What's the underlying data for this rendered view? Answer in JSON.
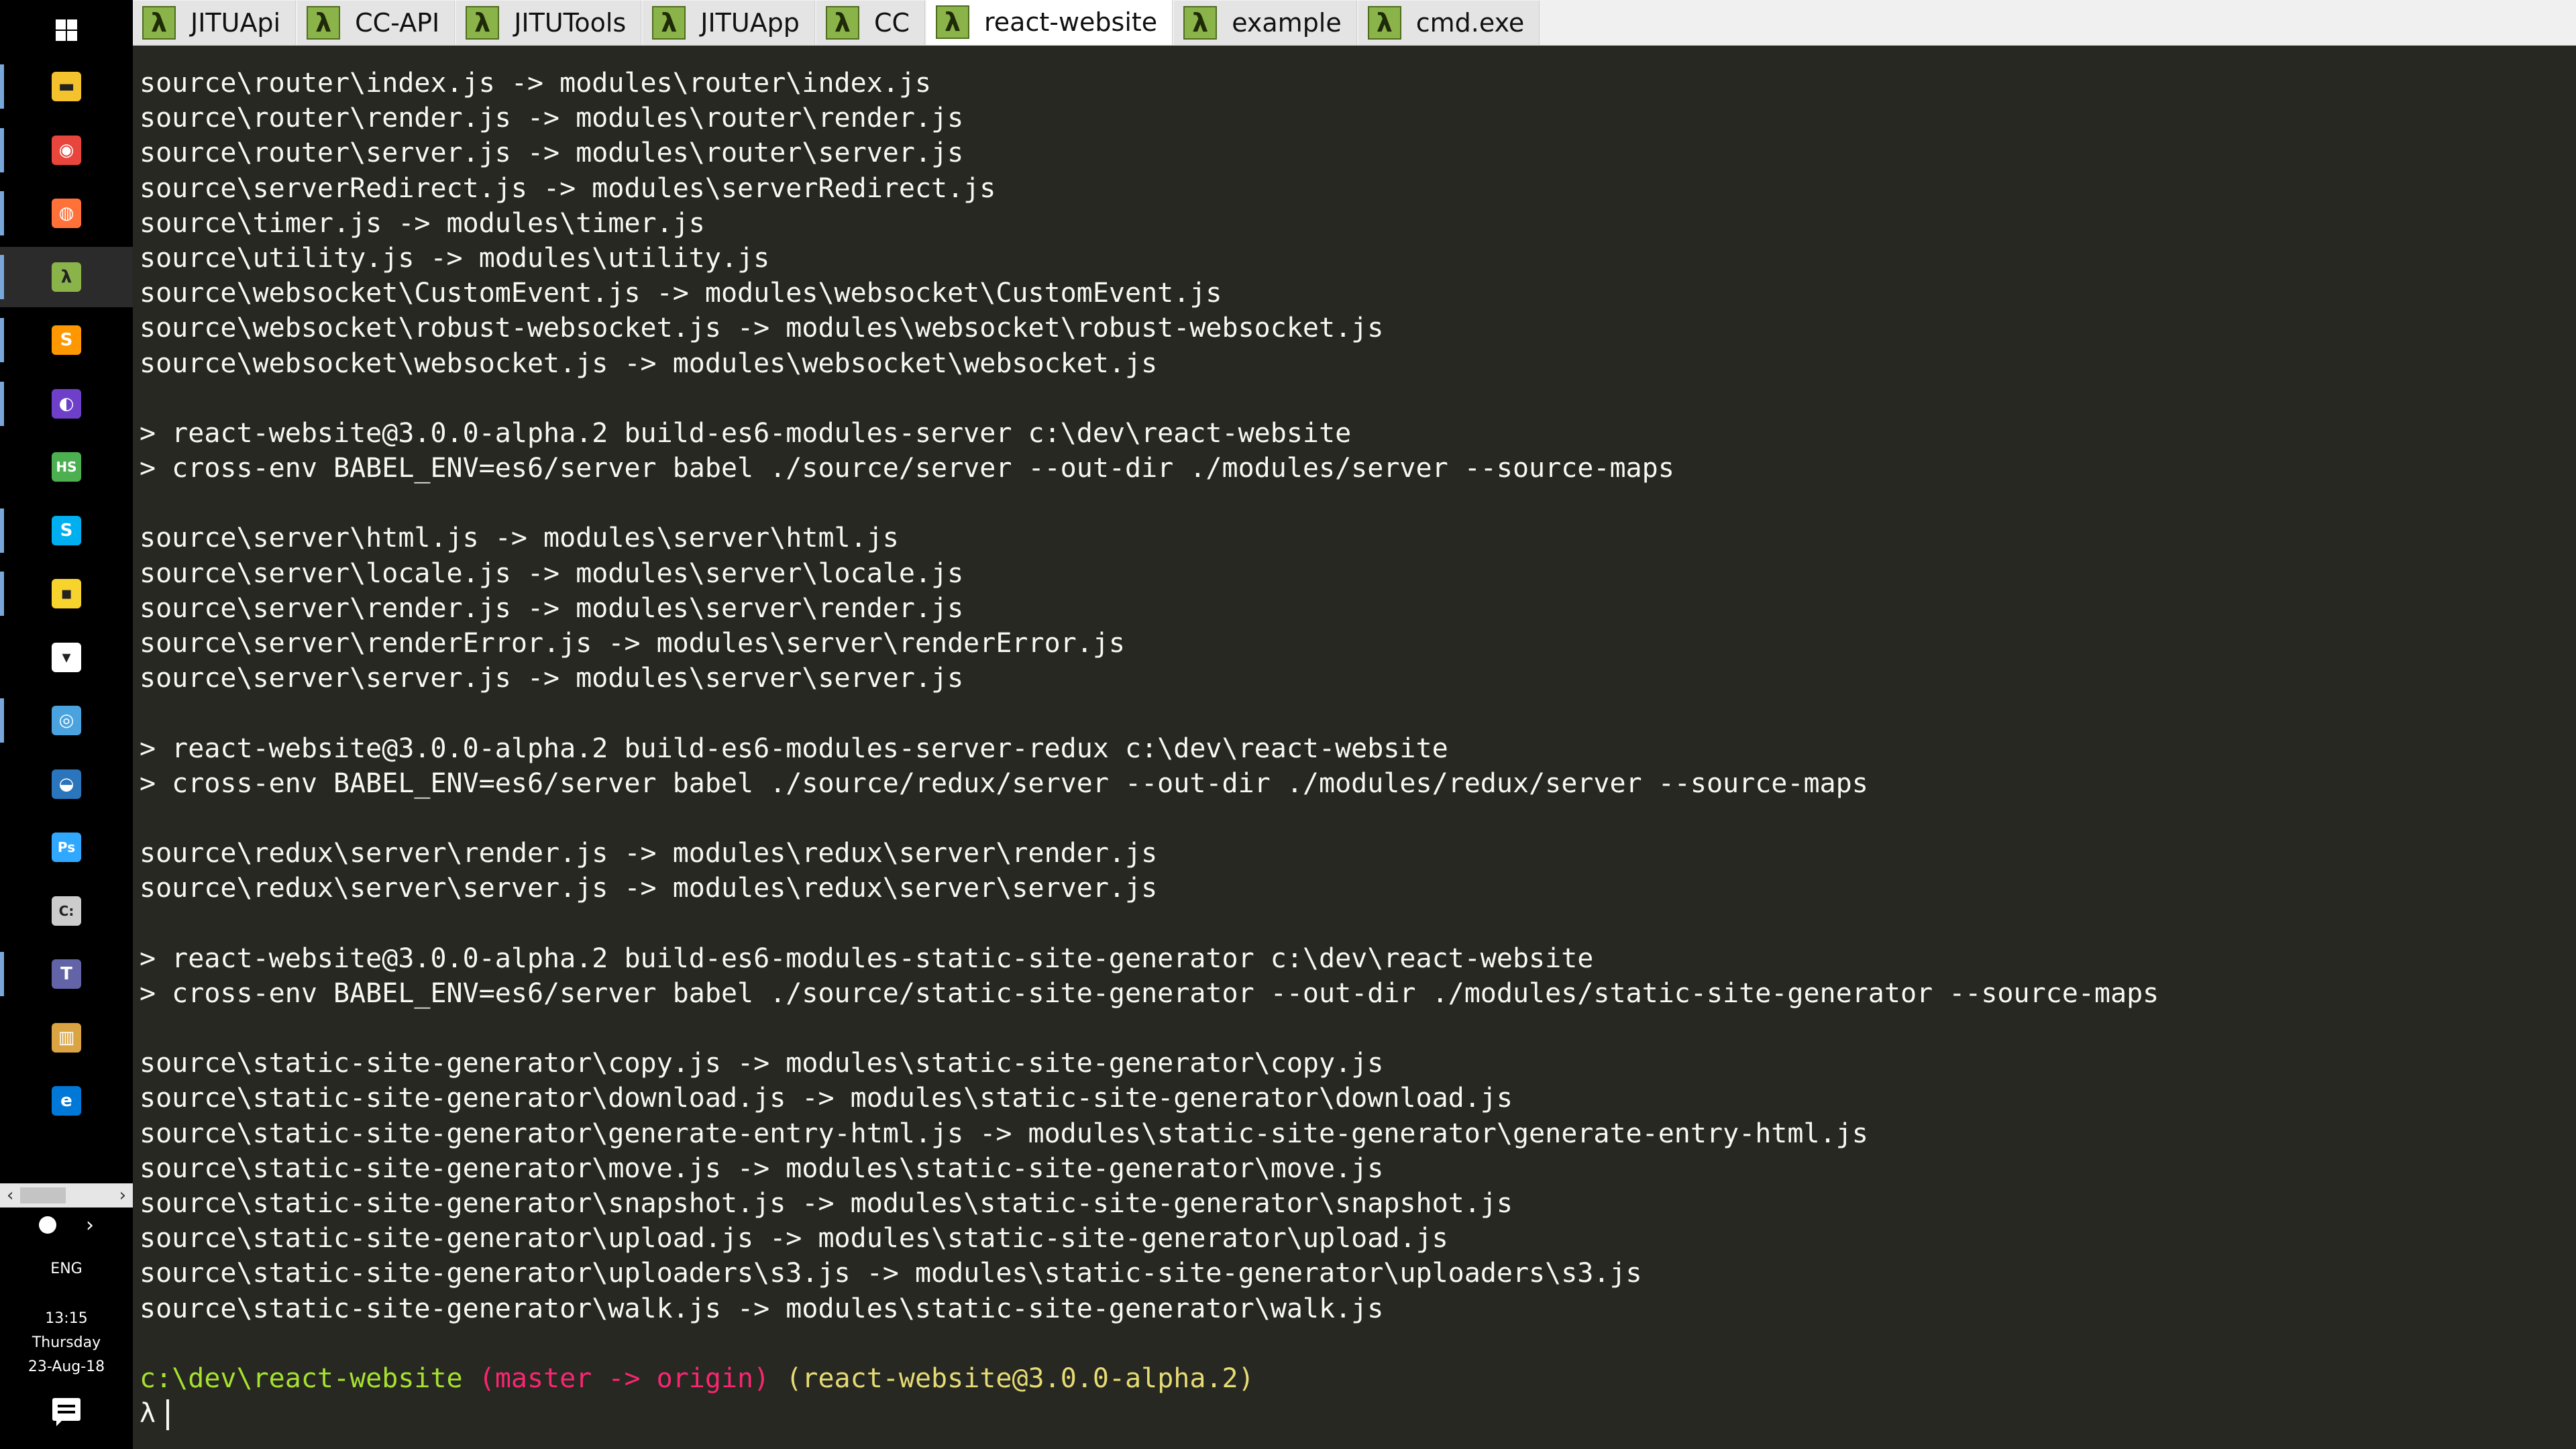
{
  "taskbar": {
    "start_icon": "windows-start-icon",
    "apps": [
      {
        "name": "file-explorer",
        "icon": "folder-icon",
        "color": "#f3c22d",
        "running": true
      },
      {
        "name": "chrome",
        "icon": "chrome-icon",
        "color": "#e8453c",
        "running": true
      },
      {
        "name": "firefox",
        "icon": "firefox-icon",
        "color": "#ff7139",
        "running": true
      },
      {
        "name": "cmder",
        "icon": "cmder-icon",
        "color": "#8ab34a",
        "running": true,
        "active": true
      },
      {
        "name": "sublime-text",
        "icon": "sublime-icon",
        "color": "#ff9800",
        "running": true
      },
      {
        "name": "github-desktop",
        "icon": "github-icon",
        "color": "#6e40c9",
        "running": true
      },
      {
        "name": "hubstaff",
        "icon": "hs-icon",
        "color": "#4caf50",
        "running": false
      },
      {
        "name": "skype",
        "icon": "skype-icon",
        "color": "#00aff0",
        "running": true
      },
      {
        "name": "sticky",
        "icon": "sticky-notes-icon",
        "color": "#f6d32d",
        "running": true
      },
      {
        "name": "fox",
        "icon": "fox-icon",
        "color": "#ffffff",
        "running": false
      },
      {
        "name": "eye",
        "icon": "eye-icon",
        "color": "#4aa3df",
        "running": true
      },
      {
        "name": "steam",
        "icon": "steam-icon",
        "color": "#2a75bb",
        "running": false
      },
      {
        "name": "photoshop",
        "icon": "photoshop-icon",
        "color": "#31a8ff",
        "running": false
      },
      {
        "name": "command-prompt",
        "icon": "cmd-icon",
        "color": "#cccccc",
        "running": false
      },
      {
        "name": "teams",
        "icon": "teams-icon",
        "color": "#6264a7",
        "running": true
      },
      {
        "name": "library",
        "icon": "library-icon",
        "color": "#d9a441",
        "running": false
      },
      {
        "name": "edge",
        "icon": "edge-icon",
        "color": "#0078d7",
        "running": false
      }
    ],
    "scroll_left": "‹",
    "scroll_right": "›",
    "tray": {
      "chevron": "›",
      "language": "ENG",
      "time": "13:15",
      "day": "Thursday",
      "date": "23-Aug-18"
    }
  },
  "tabs": [
    {
      "label": "JITUApi",
      "active": false
    },
    {
      "label": "CC-API",
      "active": false
    },
    {
      "label": "JITUTools",
      "active": false
    },
    {
      "label": "JITUApp",
      "active": false
    },
    {
      "label": "CC",
      "active": false
    },
    {
      "label": "react-website",
      "active": true
    },
    {
      "label": "example",
      "active": false
    },
    {
      "label": "cmd.exe",
      "active": false
    }
  ],
  "terminal": {
    "lines": [
      "source\\router\\index.js -> modules\\router\\index.js",
      "source\\router\\render.js -> modules\\router\\render.js",
      "source\\router\\server.js -> modules\\router\\server.js",
      "source\\serverRedirect.js -> modules\\serverRedirect.js",
      "source\\timer.js -> modules\\timer.js",
      "source\\utility.js -> modules\\utility.js",
      "source\\websocket\\CustomEvent.js -> modules\\websocket\\CustomEvent.js",
      "source\\websocket\\robust-websocket.js -> modules\\websocket\\robust-websocket.js",
      "source\\websocket\\websocket.js -> modules\\websocket\\websocket.js",
      "",
      "> react-website@3.0.0-alpha.2 build-es6-modules-server c:\\dev\\react-website",
      "> cross-env BABEL_ENV=es6/server babel ./source/server --out-dir ./modules/server --source-maps",
      "",
      "source\\server\\html.js -> modules\\server\\html.js",
      "source\\server\\locale.js -> modules\\server\\locale.js",
      "source\\server\\render.js -> modules\\server\\render.js",
      "source\\server\\renderError.js -> modules\\server\\renderError.js",
      "source\\server\\server.js -> modules\\server\\server.js",
      "",
      "> react-website@3.0.0-alpha.2 build-es6-modules-server-redux c:\\dev\\react-website",
      "> cross-env BABEL_ENV=es6/server babel ./source/redux/server --out-dir ./modules/redux/server --source-maps",
      "",
      "source\\redux\\server\\render.js -> modules\\redux\\server\\render.js",
      "source\\redux\\server\\server.js -> modules\\redux\\server\\server.js",
      "",
      "> react-website@3.0.0-alpha.2 build-es6-modules-static-site-generator c:\\dev\\react-website",
      "> cross-env BABEL_ENV=es6/server babel ./source/static-site-generator --out-dir ./modules/static-site-generator --source-maps",
      "",
      "source\\static-site-generator\\copy.js -> modules\\static-site-generator\\copy.js",
      "source\\static-site-generator\\download.js -> modules\\static-site-generator\\download.js",
      "source\\static-site-generator\\generate-entry-html.js -> modules\\static-site-generator\\generate-entry-html.js",
      "source\\static-site-generator\\move.js -> modules\\static-site-generator\\move.js",
      "source\\static-site-generator\\snapshot.js -> modules\\static-site-generator\\snapshot.js",
      "source\\static-site-generator\\upload.js -> modules\\static-site-generator\\upload.js",
      "source\\static-site-generator\\uploaders\\s3.js -> modules\\static-site-generator\\uploaders\\s3.js",
      "source\\static-site-generator\\walk.js -> modules\\static-site-generator\\walk.js",
      ""
    ],
    "prompt": {
      "path": "c:\\dev\\react-website",
      "git": "(master -> origin)",
      "package": "(react-website@3.0.0-alpha.2)",
      "symbol": "λ"
    },
    "colors": {
      "background": "#272822",
      "text": "#f8f8f2",
      "path": "#a6e22e",
      "git": "#f92672",
      "package": "#e6db74"
    }
  }
}
